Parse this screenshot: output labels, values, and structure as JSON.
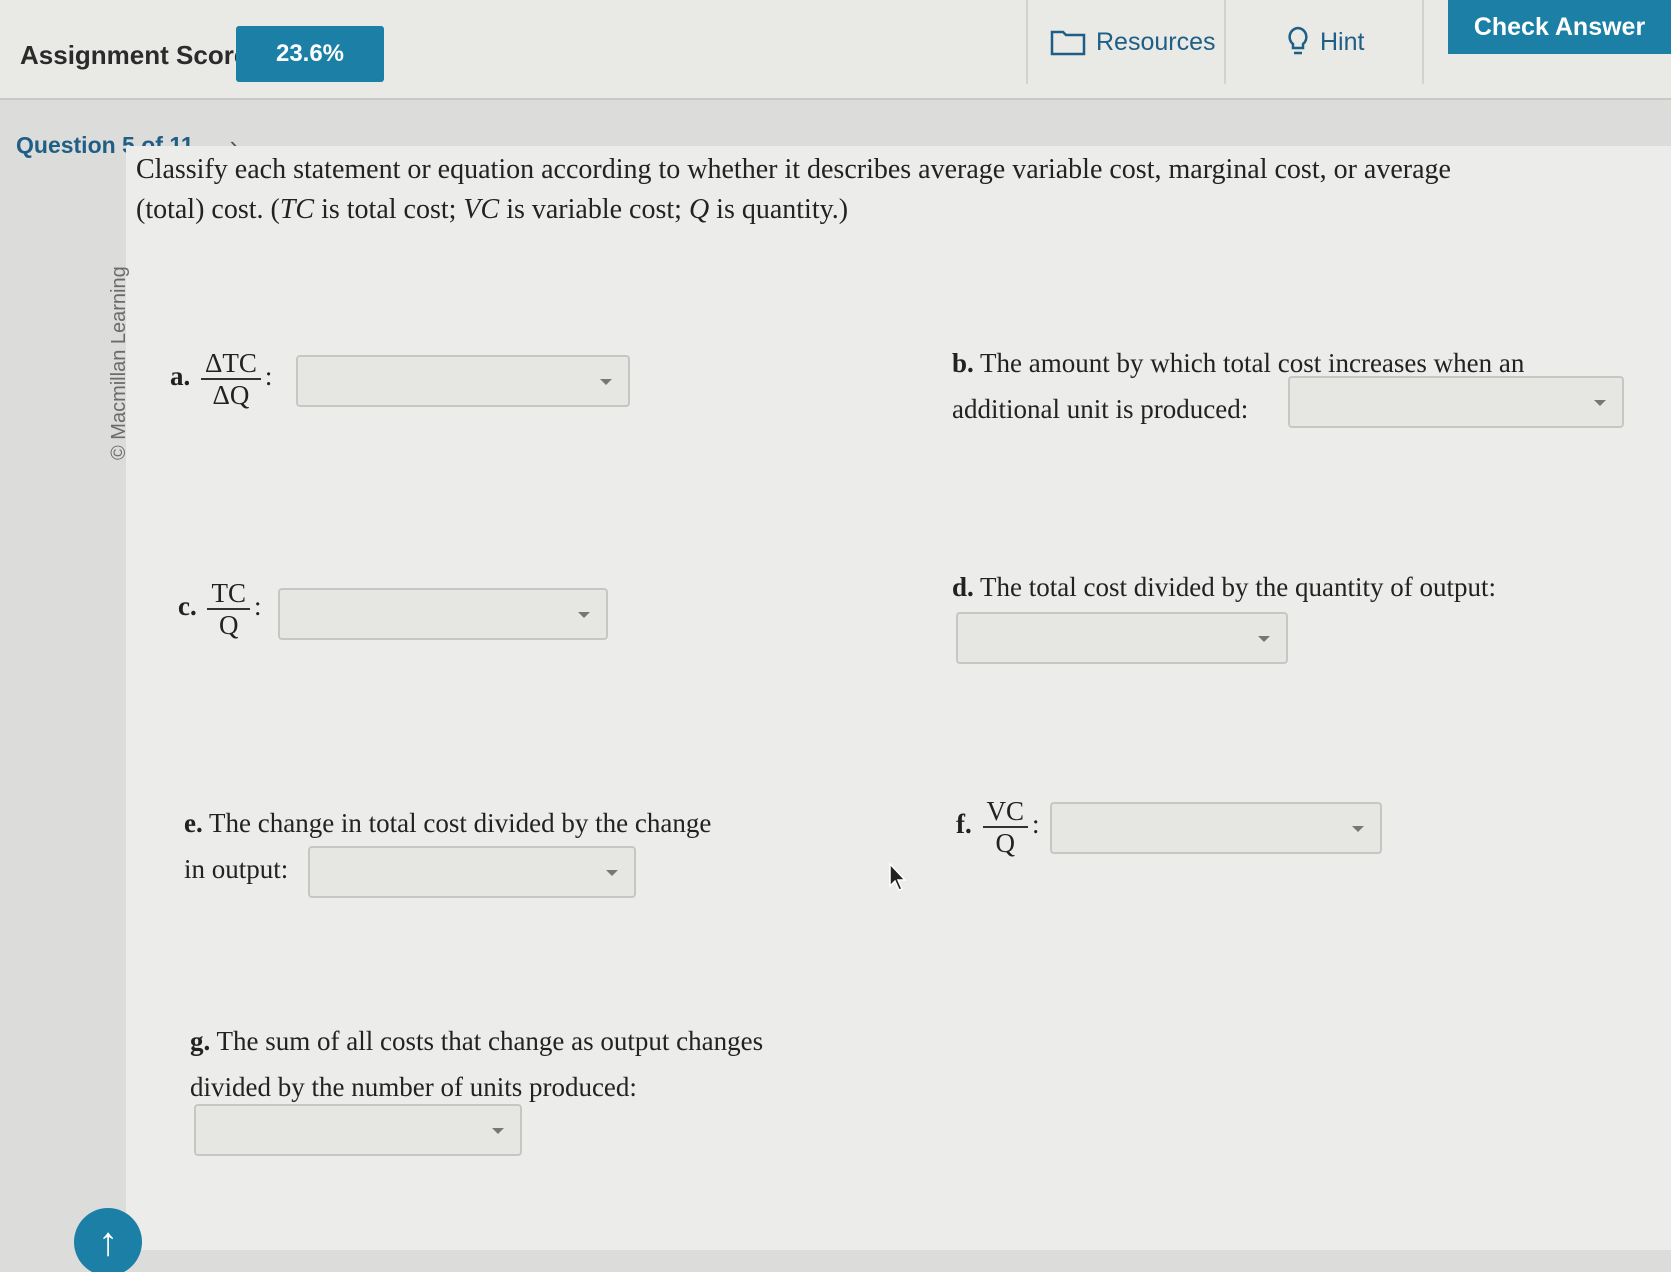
{
  "header": {
    "score_label": "Assignment Score:",
    "score_value": "23.6%",
    "resources_label": "Resources",
    "hint_label": "Hint",
    "check_answer_label": "Check Answer"
  },
  "question_nav": {
    "label": "Question 5 of 11",
    "next_icon": "chevron-right-icon"
  },
  "watermark": "© Macmillan Learning",
  "prompt": {
    "line1": "Classify each statement or equation according to whether it describes average variable cost, marginal cost, or average",
    "line2_a": "(total) cost. (",
    "tc": "TC",
    "line2_b": " is total cost; ",
    "vc": "VC",
    "line2_c": " is variable cost; ",
    "q": "Q",
    "line2_d": " is quantity.)"
  },
  "items": {
    "a": {
      "label": "a.",
      "num": "ΔTC",
      "den": "ΔQ",
      "suffix": ":"
    },
    "b": {
      "label": "b.",
      "line1": "The amount by which total cost increases when an",
      "line2": "additional unit is produced:"
    },
    "c": {
      "label": "c.",
      "num": "TC",
      "den": "Q",
      "suffix": ":"
    },
    "d": {
      "label": "d.",
      "text": "The total cost divided by the quantity of output:"
    },
    "e": {
      "label": "e.",
      "line1": "The change in total cost divided by the change",
      "line2": "in output:"
    },
    "f": {
      "label": "f.",
      "num": "VC",
      "den": "Q",
      "suffix": ":"
    },
    "g": {
      "label": "g.",
      "line1": "The sum of all costs that change as output changes",
      "line2": "divided by the number of units produced:"
    }
  },
  "dropdown_selected": "",
  "colors": {
    "accent": "#1b7fa6",
    "link": "#1f5f86"
  }
}
